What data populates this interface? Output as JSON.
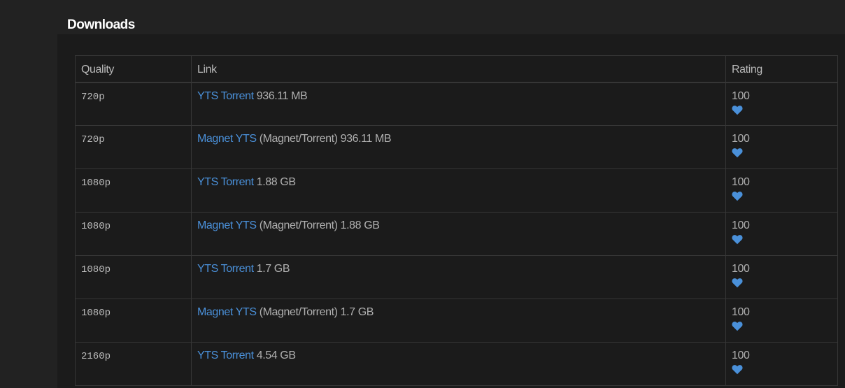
{
  "section": {
    "title": "Downloads"
  },
  "table": {
    "headers": {
      "quality": "Quality",
      "link": "Link",
      "rating": "Rating"
    },
    "rows": [
      {
        "quality": "720p",
        "link_text": "YTS Torrent",
        "details": " 936.11 MB",
        "rating": "100"
      },
      {
        "quality": "720p",
        "link_text": "Magnet YTS",
        "details": " (Magnet/Torrent) 936.11 MB",
        "rating": "100"
      },
      {
        "quality": "1080p",
        "link_text": "YTS Torrent",
        "details": " 1.88 GB",
        "rating": "100"
      },
      {
        "quality": "1080p",
        "link_text": "Magnet YTS",
        "details": " (Magnet/Torrent) 1.88 GB",
        "rating": "100"
      },
      {
        "quality": "1080p",
        "link_text": "YTS Torrent",
        "details": " 1.7 GB",
        "rating": "100"
      },
      {
        "quality": "1080p",
        "link_text": "Magnet YTS",
        "details": " (Magnet/Torrent) 1.7 GB",
        "rating": "100"
      },
      {
        "quality": "2160p",
        "link_text": "YTS Torrent",
        "details": " 4.54 GB",
        "rating": "100"
      }
    ]
  },
  "icons": {
    "rating": "heart-icon"
  },
  "colors": {
    "link": "#4a90d9",
    "heart": "#4a90d9",
    "background": "#222222",
    "panel": "#1b1b1b"
  }
}
